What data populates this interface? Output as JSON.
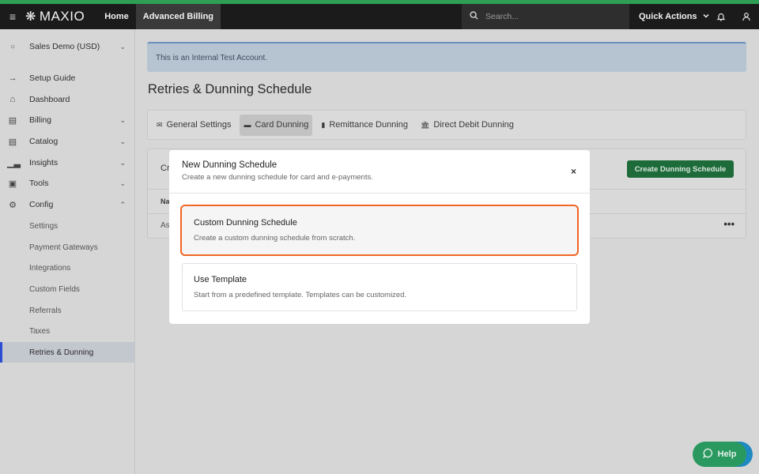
{
  "colors": {
    "accent": "#2f9e55",
    "topbar": "#1b1b1b",
    "primary_button": "#1e6b3a",
    "selection_outline": "#f26522",
    "help_button": "#2a9960",
    "active_indicator": "#2b4dd4"
  },
  "topbar": {
    "menu_icon": "collapse-menu-icon",
    "logo": "MAXIO",
    "nav": [
      {
        "label": "Home"
      },
      {
        "label": "Advanced Billing"
      }
    ],
    "search": {
      "placeholder": "Search..."
    },
    "quick_actions": "Quick Actions",
    "icons": [
      "bell-icon",
      "user-icon"
    ]
  },
  "sidebar": {
    "account": "Sales Demo (USD)",
    "items": [
      {
        "label": "Setup Guide",
        "icon": "arrow-right-icon"
      },
      {
        "label": "Dashboard",
        "icon": "home-icon"
      },
      {
        "label": "Billing",
        "icon": "billing-icon"
      },
      {
        "label": "Catalog",
        "icon": "catalog-icon"
      },
      {
        "label": "Insights",
        "icon": "insights-icon"
      },
      {
        "label": "Tools",
        "icon": "briefcase-icon"
      },
      {
        "label": "Config",
        "icon": "gear-icon"
      }
    ],
    "config_sub": [
      {
        "label": "Settings"
      },
      {
        "label": "Payment Gateways"
      },
      {
        "label": "Integrations"
      },
      {
        "label": "Custom Fields"
      },
      {
        "label": "Referrals"
      },
      {
        "label": "Taxes"
      },
      {
        "label": "Retries & Dunning"
      }
    ]
  },
  "main": {
    "banner": "This is an Internal Test Account.",
    "title": "Retries & Dunning Schedule",
    "tabs": [
      {
        "label": "General Settings",
        "icon": "envelope-icon"
      },
      {
        "label": "Card Dunning",
        "icon": "credit-card-icon"
      },
      {
        "label": "Remittance Dunning",
        "icon": "document-icon"
      },
      {
        "label": "Direct Debit Dunning",
        "icon": "bank-icon"
      }
    ],
    "card": {
      "heading_fragment": "Cr",
      "create_button": "Create Dunning Schedule",
      "column_fragment": "Na",
      "row_fragment": "As",
      "row_actions": "•••"
    }
  },
  "modal": {
    "title": "New Dunning Schedule",
    "subtitle": "Create a new dunning schedule for card and e-payments.",
    "close": "×",
    "options": [
      {
        "title": "Custom Dunning Schedule",
        "desc": "Create a custom dunning schedule from scratch."
      },
      {
        "title": "Use Template",
        "desc": "Start from a predefined template. Templates can be customized."
      }
    ]
  },
  "help": {
    "label": "Help"
  }
}
